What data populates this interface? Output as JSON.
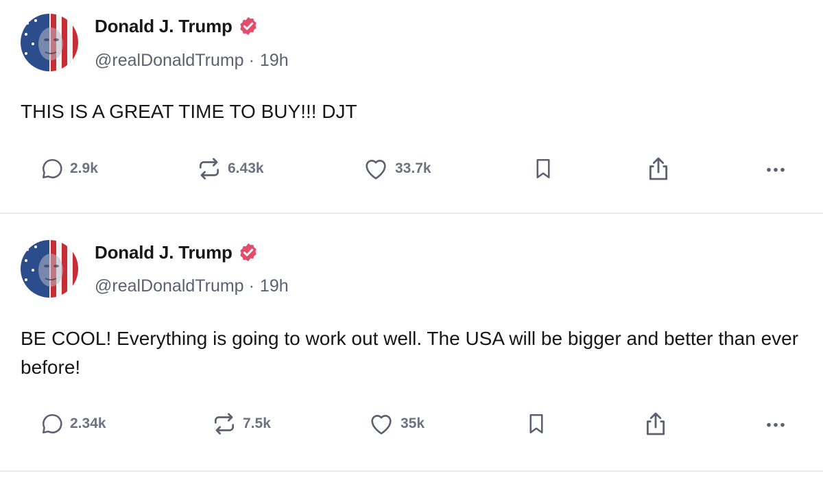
{
  "posts": [
    {
      "display_name": "Donald J. Trump",
      "handle": "@realDonaldTrump",
      "separator": "·",
      "time": "19h",
      "text": "THIS IS A GREAT TIME TO BUY!!! DJT",
      "replies": "2.9k",
      "reposts": "6.43k",
      "likes": "33.7k"
    },
    {
      "display_name": "Donald J. Trump",
      "handle": "@realDonaldTrump",
      "separator": "·",
      "time": "19h",
      "text": "BE COOL! Everything is going to work out well. The USA will be bigger and better than ever before!",
      "replies": "2.34k",
      "reposts": "7.5k",
      "likes": "35k"
    }
  ],
  "icons": {
    "avatar": "flag-portrait-avatar",
    "verified": "verified-badge-icon",
    "reply": "speech-bubble-icon",
    "repost": "repost-arrows-icon",
    "like": "heart-icon",
    "bookmark": "bookmark-icon",
    "share": "share-icon",
    "more": "more-dots-icon"
  },
  "colors": {
    "verified_badge": "#e34d6b",
    "text": "#17171a",
    "muted": "#5b6170",
    "divider": "#e9e9ec"
  }
}
